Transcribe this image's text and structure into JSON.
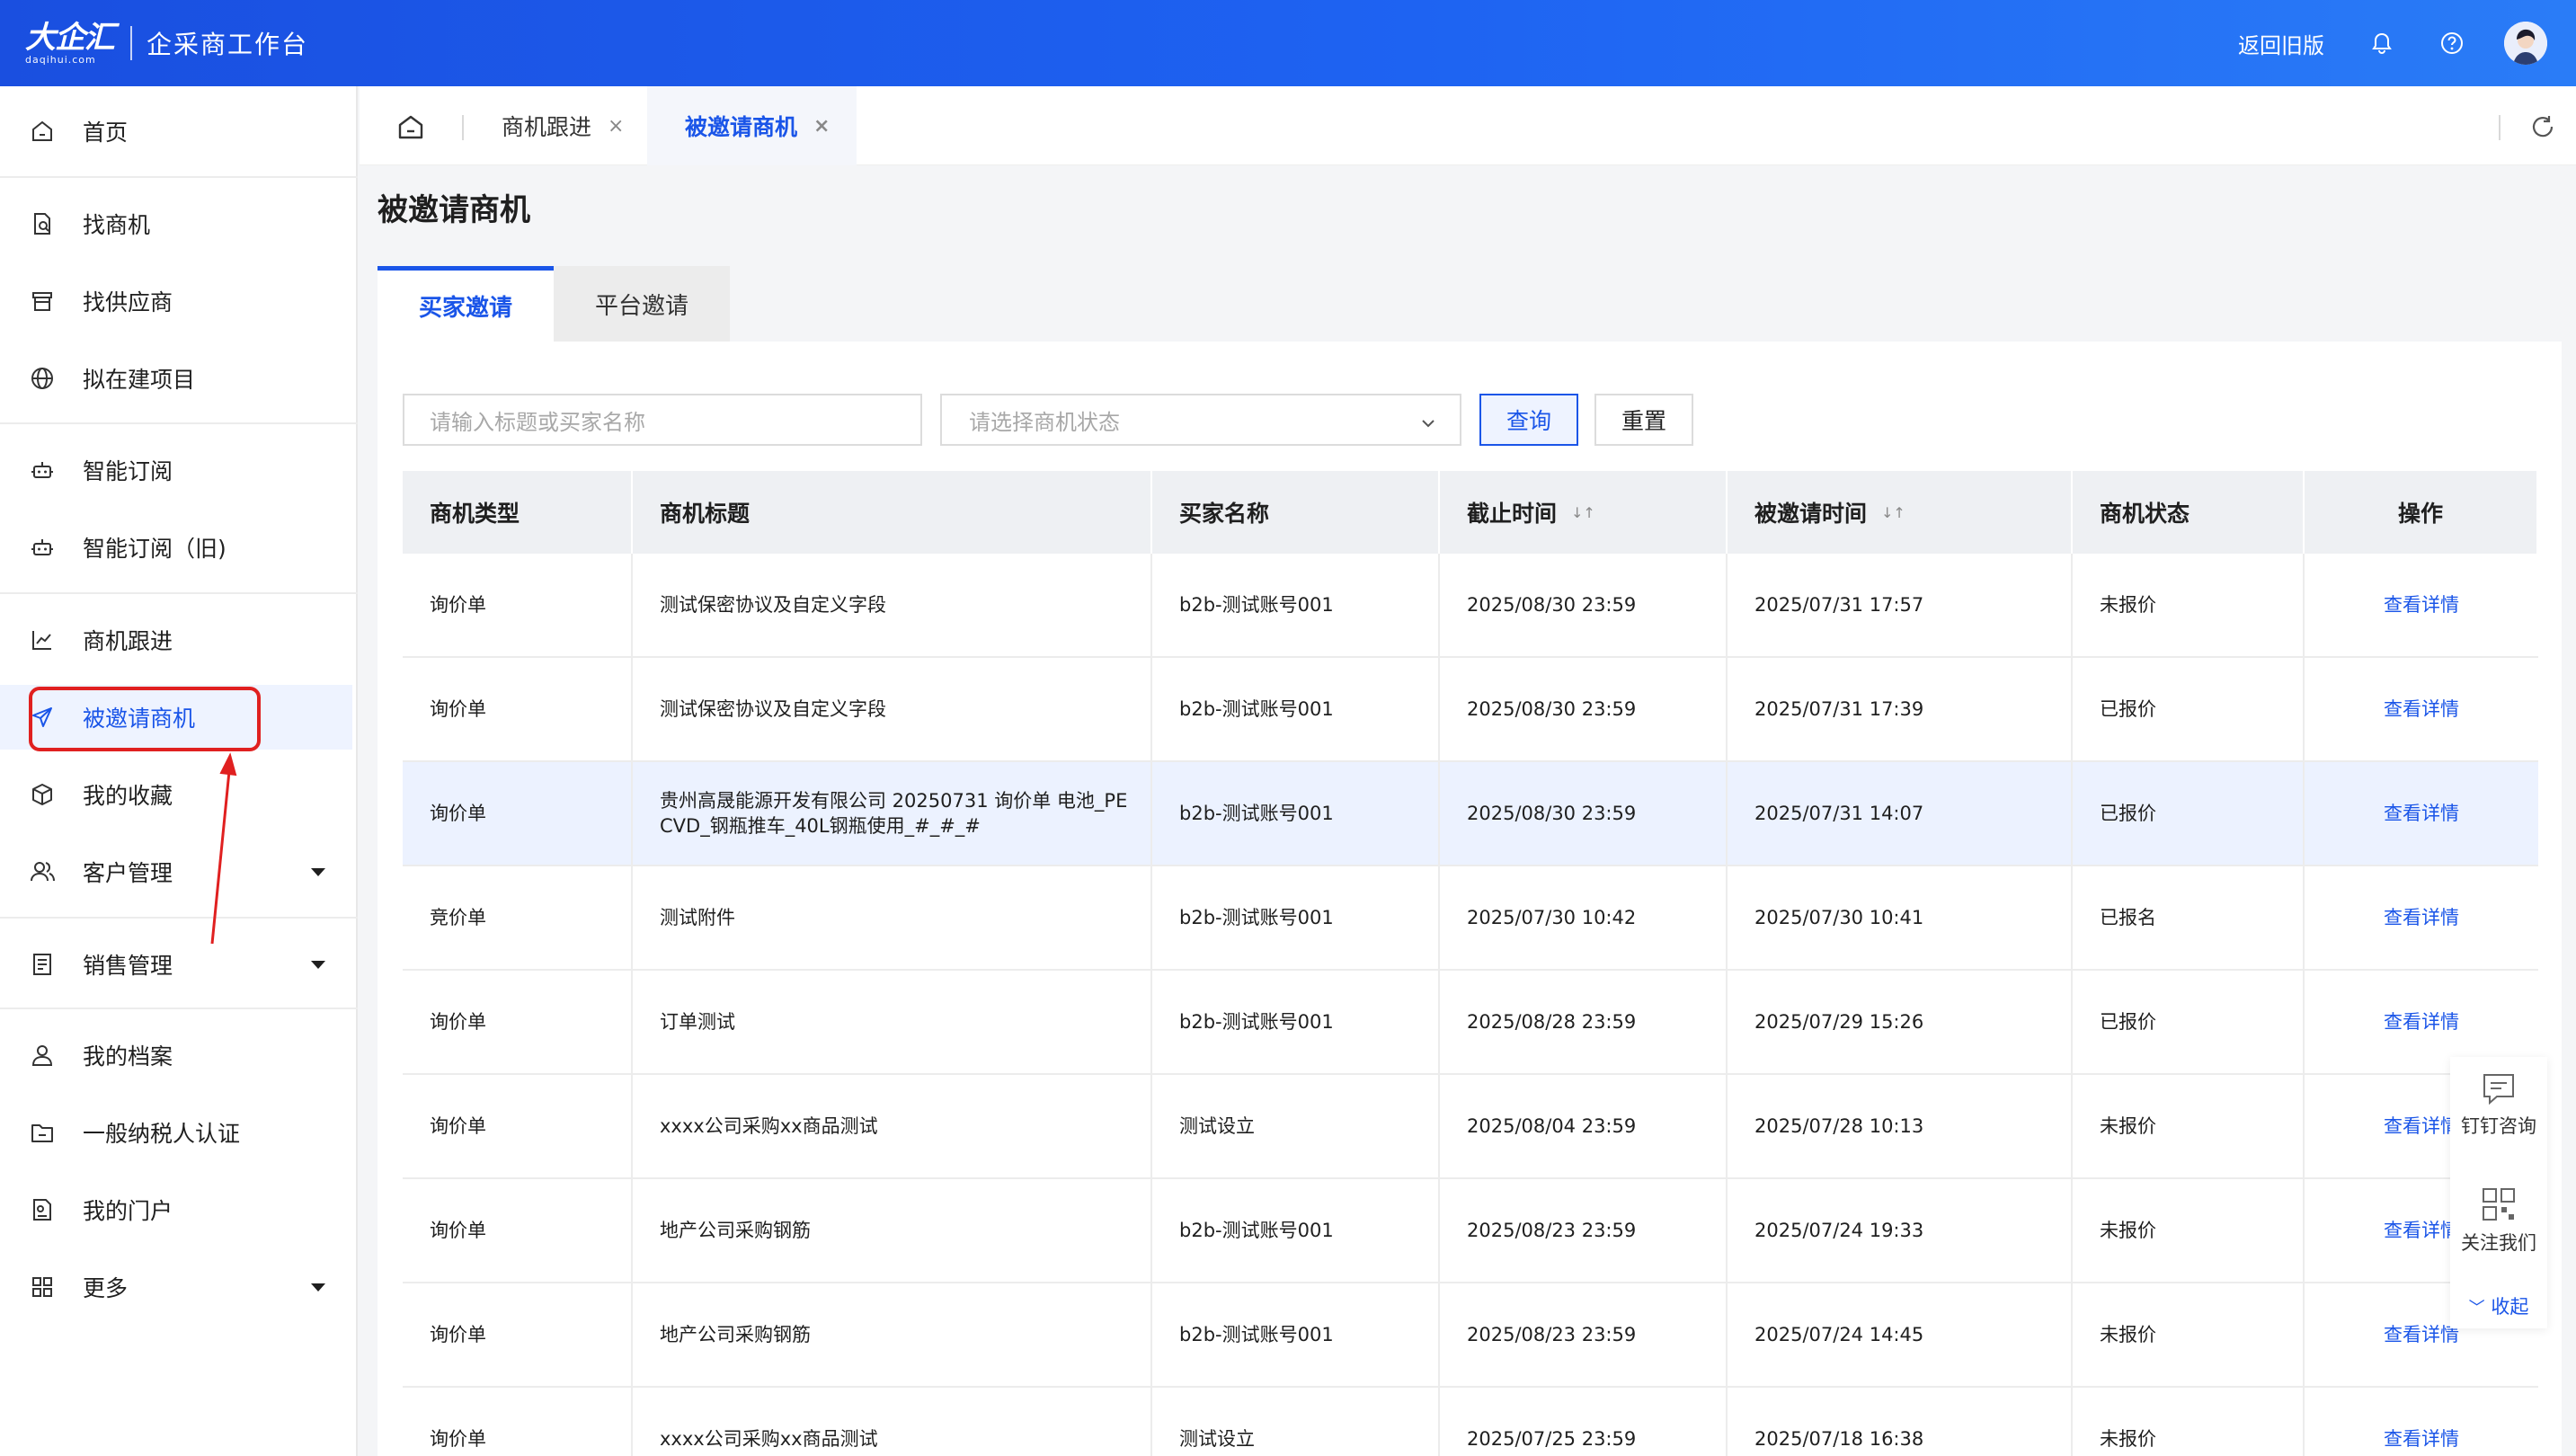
{
  "header": {
    "logo_main": "大企汇",
    "logo_sub": "daqihui.com",
    "app_title": "企采商工作台",
    "back_old": "返回旧版",
    "accent": "#1e63f2"
  },
  "sidebar": {
    "items": [
      {
        "label": "首页",
        "icon": "home-icon"
      },
      {
        "label": "找商机",
        "icon": "doc-search-icon"
      },
      {
        "label": "找供应商",
        "icon": "store-icon"
      },
      {
        "label": "拟在建项目",
        "icon": "globe-icon"
      },
      {
        "label": "智能订阅",
        "icon": "robot-icon"
      },
      {
        "label": "智能订阅（旧)",
        "icon": "robot-icon"
      },
      {
        "label": "商机跟进",
        "icon": "chart-icon"
      },
      {
        "label": "被邀请商机",
        "icon": "send-icon"
      },
      {
        "label": "我的收藏",
        "icon": "cube-icon"
      },
      {
        "label": "客户管理",
        "icon": "users-icon"
      },
      {
        "label": "销售管理",
        "icon": "list-icon"
      },
      {
        "label": "我的档案",
        "icon": "user-icon"
      },
      {
        "label": "一般纳税人认证",
        "icon": "folder-icon"
      },
      {
        "label": "我的门户",
        "icon": "portal-icon"
      },
      {
        "label": "更多",
        "icon": "grid-icon"
      }
    ]
  },
  "tabs": [
    {
      "label": "商机跟进",
      "close": "×"
    },
    {
      "label": "被邀请商机",
      "close": "×"
    }
  ],
  "page": {
    "title": "被邀请商机",
    "subtabs": [
      "买家邀请",
      "平台邀请"
    ]
  },
  "filters": {
    "title_placeholder": "请输入标题或买家名称",
    "status_placeholder": "请选择商机状态",
    "query": "查询",
    "reset": "重置"
  },
  "table": {
    "columns": [
      "商机类型",
      "商机标题",
      "买家名称",
      "截止时间",
      "被邀请时间",
      "商机状态",
      "操作"
    ],
    "sort_mark": "↓↑",
    "rows": [
      {
        "type": "询价单",
        "title": "测试保密协议及自定义字段",
        "buyer": "b2b-测试账号001",
        "deadline": "2025/08/30 23:59",
        "invited": "2025/07/31 17:57",
        "status": "未报价",
        "action": "查看详情"
      },
      {
        "type": "询价单",
        "title": "测试保密协议及自定义字段",
        "buyer": "b2b-测试账号001",
        "deadline": "2025/08/30 23:59",
        "invited": "2025/07/31 17:39",
        "status": "已报价",
        "action": "查看详情"
      },
      {
        "type": "询价单",
        "title": "贵州高晟能源开发有限公司 20250731 询价单 电池_PECVD_钢瓶推车_40L钢瓶使用_#_#_#",
        "buyer": "b2b-测试账号001",
        "deadline": "2025/08/30 23:59",
        "invited": "2025/07/31 14:07",
        "status": "已报价",
        "action": "查看详情"
      },
      {
        "type": "竞价单",
        "title": "测试附件",
        "buyer": "b2b-测试账号001",
        "deadline": "2025/07/30 10:42",
        "invited": "2025/07/30 10:41",
        "status": "已报名",
        "action": "查看详情"
      },
      {
        "type": "询价单",
        "title": "订单测试",
        "buyer": "b2b-测试账号001",
        "deadline": "2025/08/28 23:59",
        "invited": "2025/07/29 15:26",
        "status": "已报价",
        "action": "查看详情"
      },
      {
        "type": "询价单",
        "title": "xxxx公司采购xx商品测试",
        "buyer": "测试设立",
        "deadline": "2025/08/04 23:59",
        "invited": "2025/07/28 10:13",
        "status": "未报价",
        "action": "查看详情"
      },
      {
        "type": "询价单",
        "title": "地产公司采购钢筋",
        "buyer": "b2b-测试账号001",
        "deadline": "2025/08/23 23:59",
        "invited": "2025/07/24 19:33",
        "status": "未报价",
        "action": "查看详情"
      },
      {
        "type": "询价单",
        "title": "地产公司采购钢筋",
        "buyer": "b2b-测试账号001",
        "deadline": "2025/08/23 23:59",
        "invited": "2025/07/24 14:45",
        "status": "未报价",
        "action": "查看详情"
      },
      {
        "type": "询价单",
        "title": "xxxx公司采购xx商品测试",
        "buyer": "测试设立",
        "deadline": "2025/07/25 23:59",
        "invited": "2025/07/18 16:38",
        "status": "未报价",
        "action": "查看详情"
      }
    ]
  },
  "float_panel": {
    "consult": "钉钉咨询",
    "follow": "关注我们",
    "collapse": "收起"
  }
}
